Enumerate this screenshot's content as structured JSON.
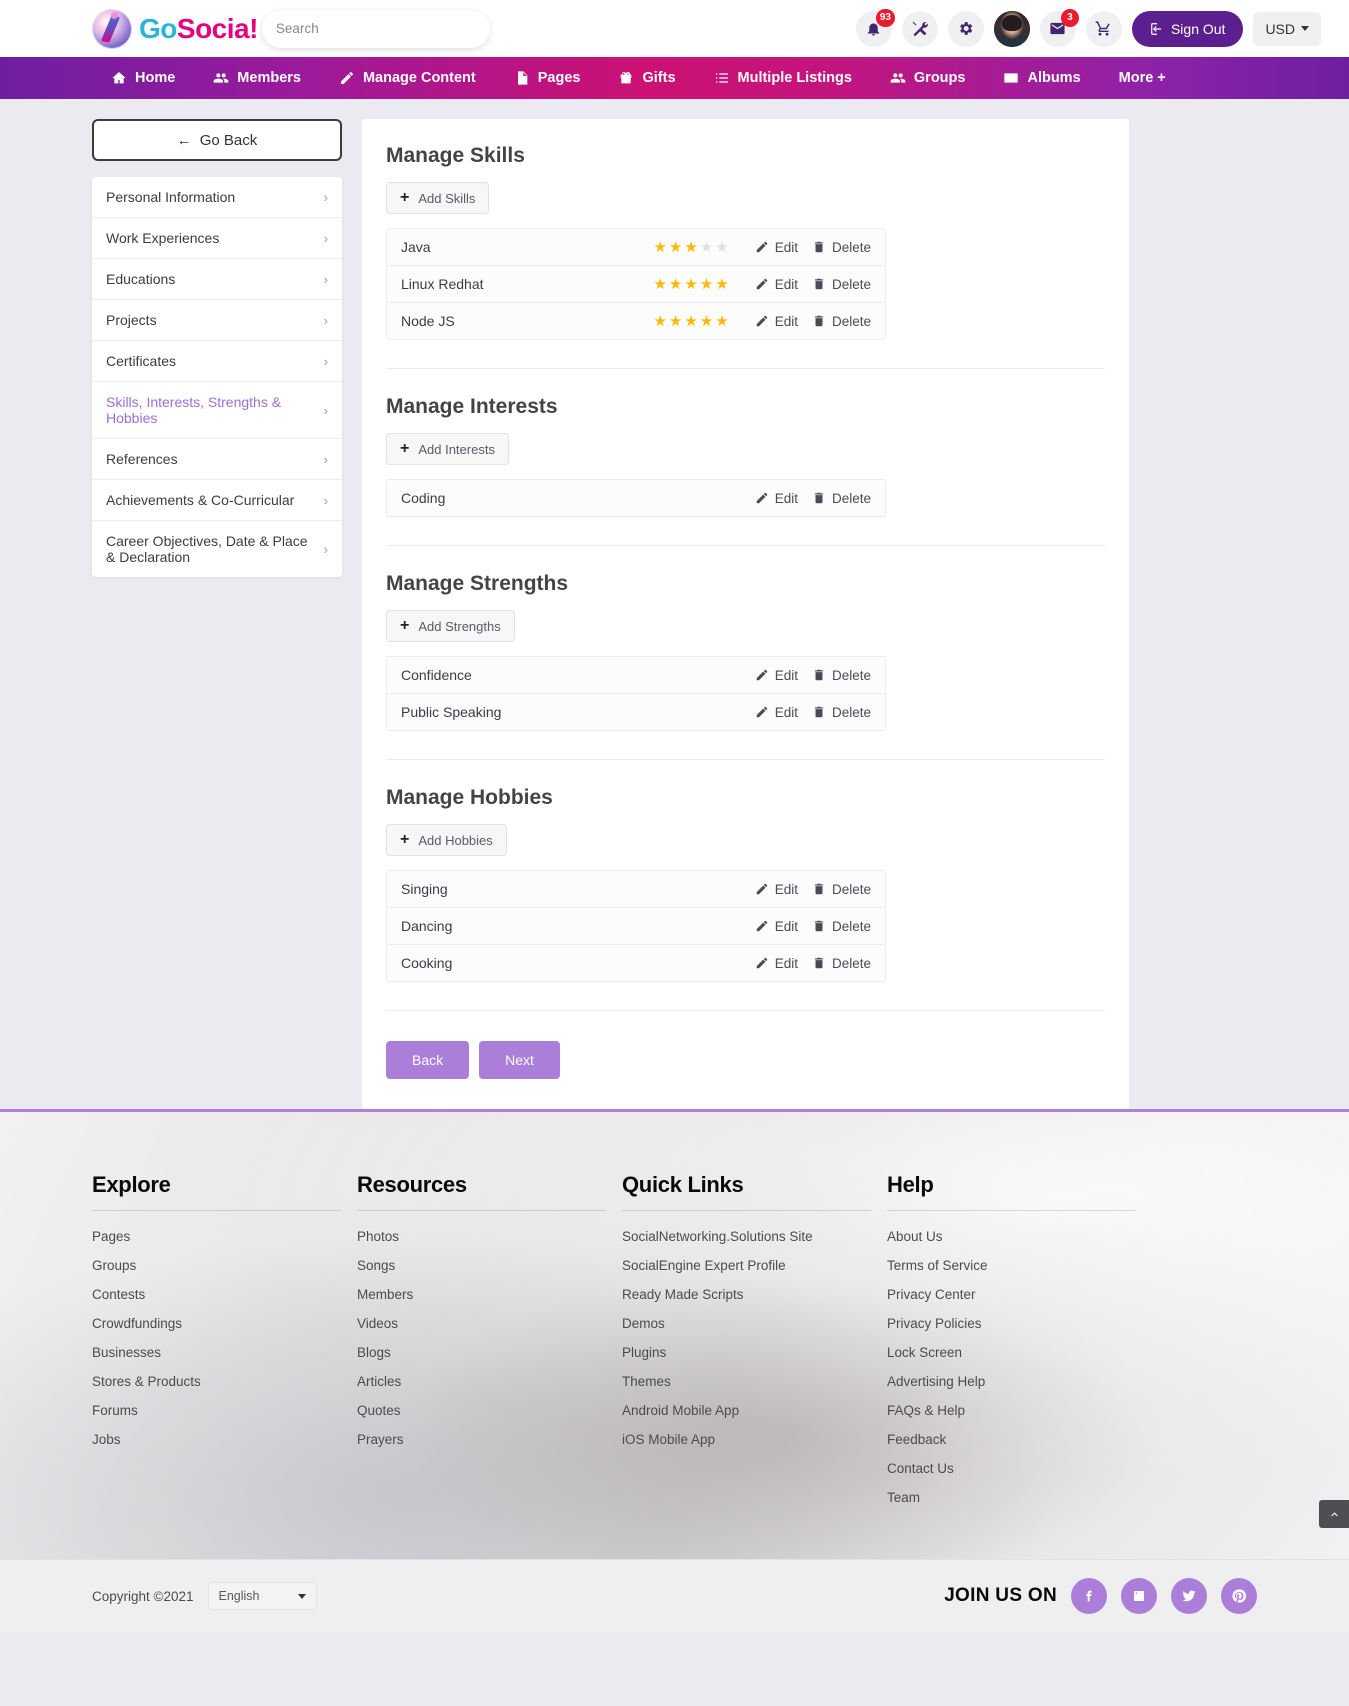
{
  "header": {
    "brand": {
      "go": "Go",
      "socia": "Socia!"
    },
    "search": {
      "placeholder": "Search",
      "value": "",
      "icon": "search-icon"
    },
    "icons": [
      {
        "name": "bell-icon",
        "badge": "93"
      },
      {
        "name": "tools-icon",
        "badge": ""
      },
      {
        "name": "gear-icon",
        "badge": ""
      }
    ],
    "avatar_alt": "user-avatar",
    "mail": {
      "name": "mail-icon",
      "badge": "3"
    },
    "cart": {
      "name": "cart-icon",
      "badge": ""
    },
    "sign_out_label": "Sign Out",
    "currency_label": "USD"
  },
  "nav": {
    "items": [
      {
        "label": "Home",
        "icon": "home-icon"
      },
      {
        "label": "Members",
        "icon": "members-icon"
      },
      {
        "label": "Manage Content",
        "icon": "pencil-icon"
      },
      {
        "label": "Pages",
        "icon": "page-icon"
      },
      {
        "label": "Gifts",
        "icon": "gift-icon"
      },
      {
        "label": "Multiple Listings",
        "icon": "list-icon"
      },
      {
        "label": "Groups",
        "icon": "groups-icon"
      },
      {
        "label": "Albums",
        "icon": "album-icon"
      },
      {
        "label": "More +",
        "icon": ""
      }
    ]
  },
  "sidebar": {
    "go_back_label": "Go Back",
    "go_back_arrow": "←",
    "chevron": "›",
    "items": [
      {
        "label": "Personal Information",
        "active": false
      },
      {
        "label": "Work Experiences",
        "active": false
      },
      {
        "label": "Educations",
        "active": false
      },
      {
        "label": "Projects",
        "active": false
      },
      {
        "label": "Certificates",
        "active": false
      },
      {
        "label": "Skills, Interests, Strengths & Hobbies",
        "active": true
      },
      {
        "label": "References",
        "active": false
      },
      {
        "label": "Achievements & Co-Curricular",
        "active": false
      },
      {
        "label": "Career Objectives, Date & Place & Declaration",
        "active": false
      }
    ]
  },
  "main": {
    "edit_label": "Edit",
    "delete_label": "Delete",
    "sections": [
      {
        "title": "Manage Skills",
        "add_label": "Add Skills",
        "has_stars": true,
        "rows": [
          {
            "name": "Java",
            "rating": 3,
            "max": 5
          },
          {
            "name": "Linux Redhat",
            "rating": 5,
            "max": 5
          },
          {
            "name": "Node JS",
            "rating": 5,
            "max": 5
          }
        ]
      },
      {
        "title": "Manage Interests",
        "add_label": "Add Interests",
        "has_stars": false,
        "rows": [
          {
            "name": "Coding"
          }
        ]
      },
      {
        "title": "Manage Strengths",
        "add_label": "Add Strengths",
        "has_stars": false,
        "rows": [
          {
            "name": "Confidence"
          },
          {
            "name": "Public Speaking"
          }
        ]
      },
      {
        "title": "Manage Hobbies",
        "add_label": "Add Hobbies",
        "has_stars": false,
        "rows": [
          {
            "name": "Singing"
          },
          {
            "name": "Dancing"
          },
          {
            "name": "Cooking"
          }
        ]
      }
    ],
    "back_label": "Back",
    "next_label": "Next"
  },
  "footer": {
    "columns": [
      {
        "head": "Explore",
        "links": [
          "Pages",
          "Groups",
          "Contests",
          "Crowdfundings",
          "Businesses",
          "Stores & Products",
          "Forums",
          "Jobs"
        ]
      },
      {
        "head": "Resources",
        "links": [
          "Photos",
          "Songs",
          "Members",
          "Videos",
          "Blogs",
          "Articles",
          "Quotes",
          "Prayers"
        ]
      },
      {
        "head": "Quick Links",
        "links": [
          "SocialNetworking.Solutions Site",
          "SocialEngine Expert Profile",
          "Ready Made Scripts",
          "Demos",
          "Plugins",
          "Themes",
          "Android Mobile App",
          "iOS Mobile App"
        ]
      },
      {
        "head": "Help",
        "links": [
          "About Us",
          "Terms of Service",
          "Privacy Center",
          "Privacy Policies",
          "Lock Screen",
          "Advertising Help",
          "FAQs & Help",
          "Feedback",
          "Contact Us",
          "Team"
        ]
      }
    ],
    "copyright": "Copyright ©2021",
    "language": "English",
    "join_label": "JOIN US ON",
    "social": [
      {
        "name": "facebook-icon"
      },
      {
        "name": "linkedin-icon"
      },
      {
        "name": "twitter-icon"
      },
      {
        "name": "pinterest-icon"
      }
    ]
  },
  "colors": {
    "brand_pink": "#e6007e",
    "brand_cyan": "#29b6d8",
    "nav_purple": "#6d1fa0",
    "accent_purple": "#ab7fd9",
    "star_gold": "#ffb803",
    "badge_red": "#e81c2e"
  }
}
